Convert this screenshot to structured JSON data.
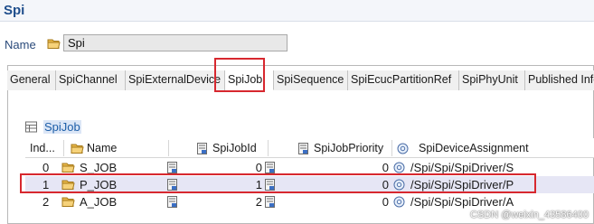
{
  "editor": {
    "title": "Spi"
  },
  "name_field": {
    "label": "Name",
    "value": "Spi"
  },
  "tabs": [
    {
      "label": "General"
    },
    {
      "label": "SpiChannel"
    },
    {
      "label": "SpiExternalDevice"
    },
    {
      "label": "SpiJob",
      "active": true
    },
    {
      "label": "SpiSequence"
    },
    {
      "label": "SpiEcucPartitionRef"
    },
    {
      "label": "SpiPhyUnit"
    },
    {
      "label": "Published Info"
    }
  ],
  "section": {
    "title": "SpiJob"
  },
  "table": {
    "columns": [
      "Ind...",
      "Name",
      "SpiJobId",
      "SpiJobPriority",
      "SpiDeviceAssignment"
    ],
    "rows": [
      {
        "index": "0",
        "name": "S_JOB",
        "job_id": "0",
        "priority": "0",
        "device": "/Spi/Spi/SpiDriver/S"
      },
      {
        "index": "1",
        "name": "P_JOB",
        "job_id": "1",
        "priority": "0",
        "device": "/Spi/Spi/SpiDriver/P"
      },
      {
        "index": "2",
        "name": "A_JOB",
        "job_id": "2",
        "priority": "0",
        "device": "/Spi/Spi/SpiDriver/A"
      }
    ]
  },
  "watermark": "CSDN @weixin_43586400",
  "colors": {
    "highlight": "#d7282f",
    "title": "#1f4e8c",
    "link": "#1d5ea8"
  }
}
